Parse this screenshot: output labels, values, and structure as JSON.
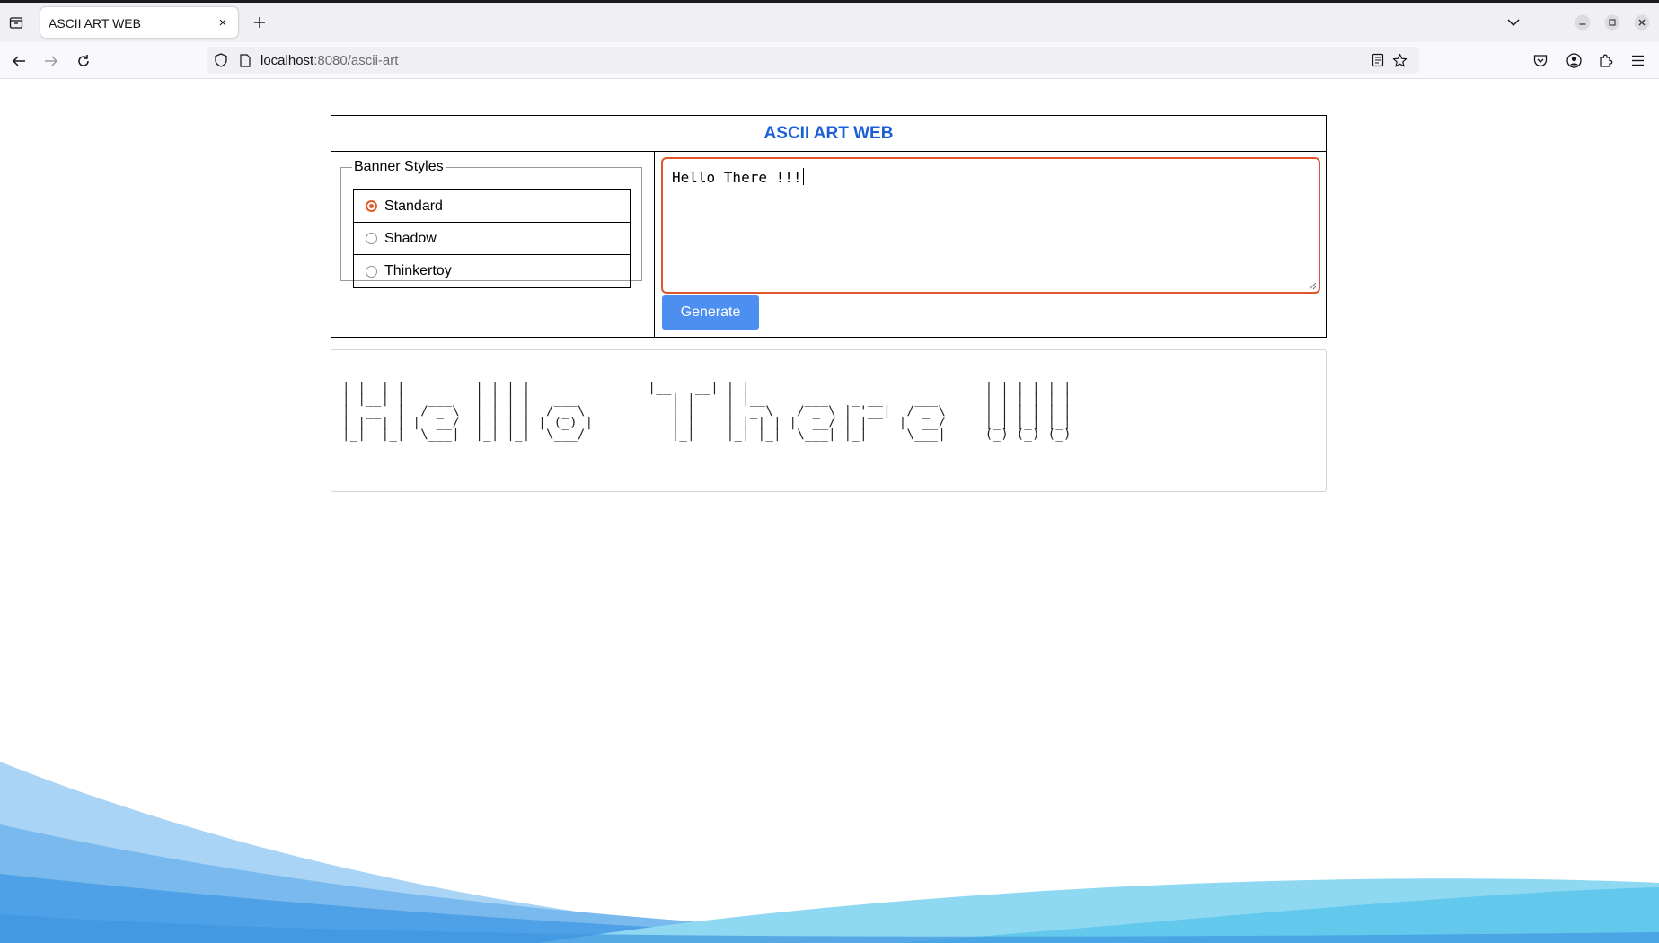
{
  "browser": {
    "tab_title": "ASCII ART WEB",
    "tab_close_glyph": "×",
    "url_host": "localhost",
    "url_path": ":8080/ascii-art",
    "icons": [
      "tab-list-icon",
      "close-icon",
      "plus-icon",
      "chevron-down-icon",
      "minimize-icon",
      "restore-icon",
      "window-close-icon",
      "back-arrow-icon",
      "forward-arrow-icon",
      "reload-icon",
      "shield-icon",
      "page-icon",
      "reader-view-icon",
      "bookmark-star-icon",
      "pocket-icon",
      "account-icon",
      "extensions-icon",
      "menu-icon"
    ]
  },
  "app": {
    "title": "ASCII ART WEB",
    "title_color": "#1a5fd8",
    "banner_legend": "Banner Styles",
    "banners": [
      {
        "label": "Standard",
        "checked": true
      },
      {
        "label": "Shadow",
        "checked": false
      },
      {
        "label": "Thinkertoy",
        "checked": false
      }
    ],
    "input_text": "Hello There !!!",
    "generate_label": "Generate",
    "accent_color": "#e0552b",
    "button_color": "#4c8ff0",
    "ascii_output": " _    _           _   _                 _______   _                                _   _   _  \n| |  | |         | | | |               |__   __| | |                              | | | | | | \n| |__| |   ___   | | | |   ___            | |    | |__     ___   _ __    ___      | | | | | | \n|  __  |  / _ \\  | | | |  / _ \\           | |    |  _ \\   / _ \\ | '__|  / _ \\     | | | | | | \n| |  | | |  __/  | | | | | (_) |          | |    | | | | |  __/ | |    |  __/     |_| |_| |_| \n|_|  |_|  \\___|  |_| |_|  \\___/           |_|    |_| |_|  \\___| |_|     \\___|     (_) (_) (_) \n                                                                                              \n                                                                                              "
  }
}
